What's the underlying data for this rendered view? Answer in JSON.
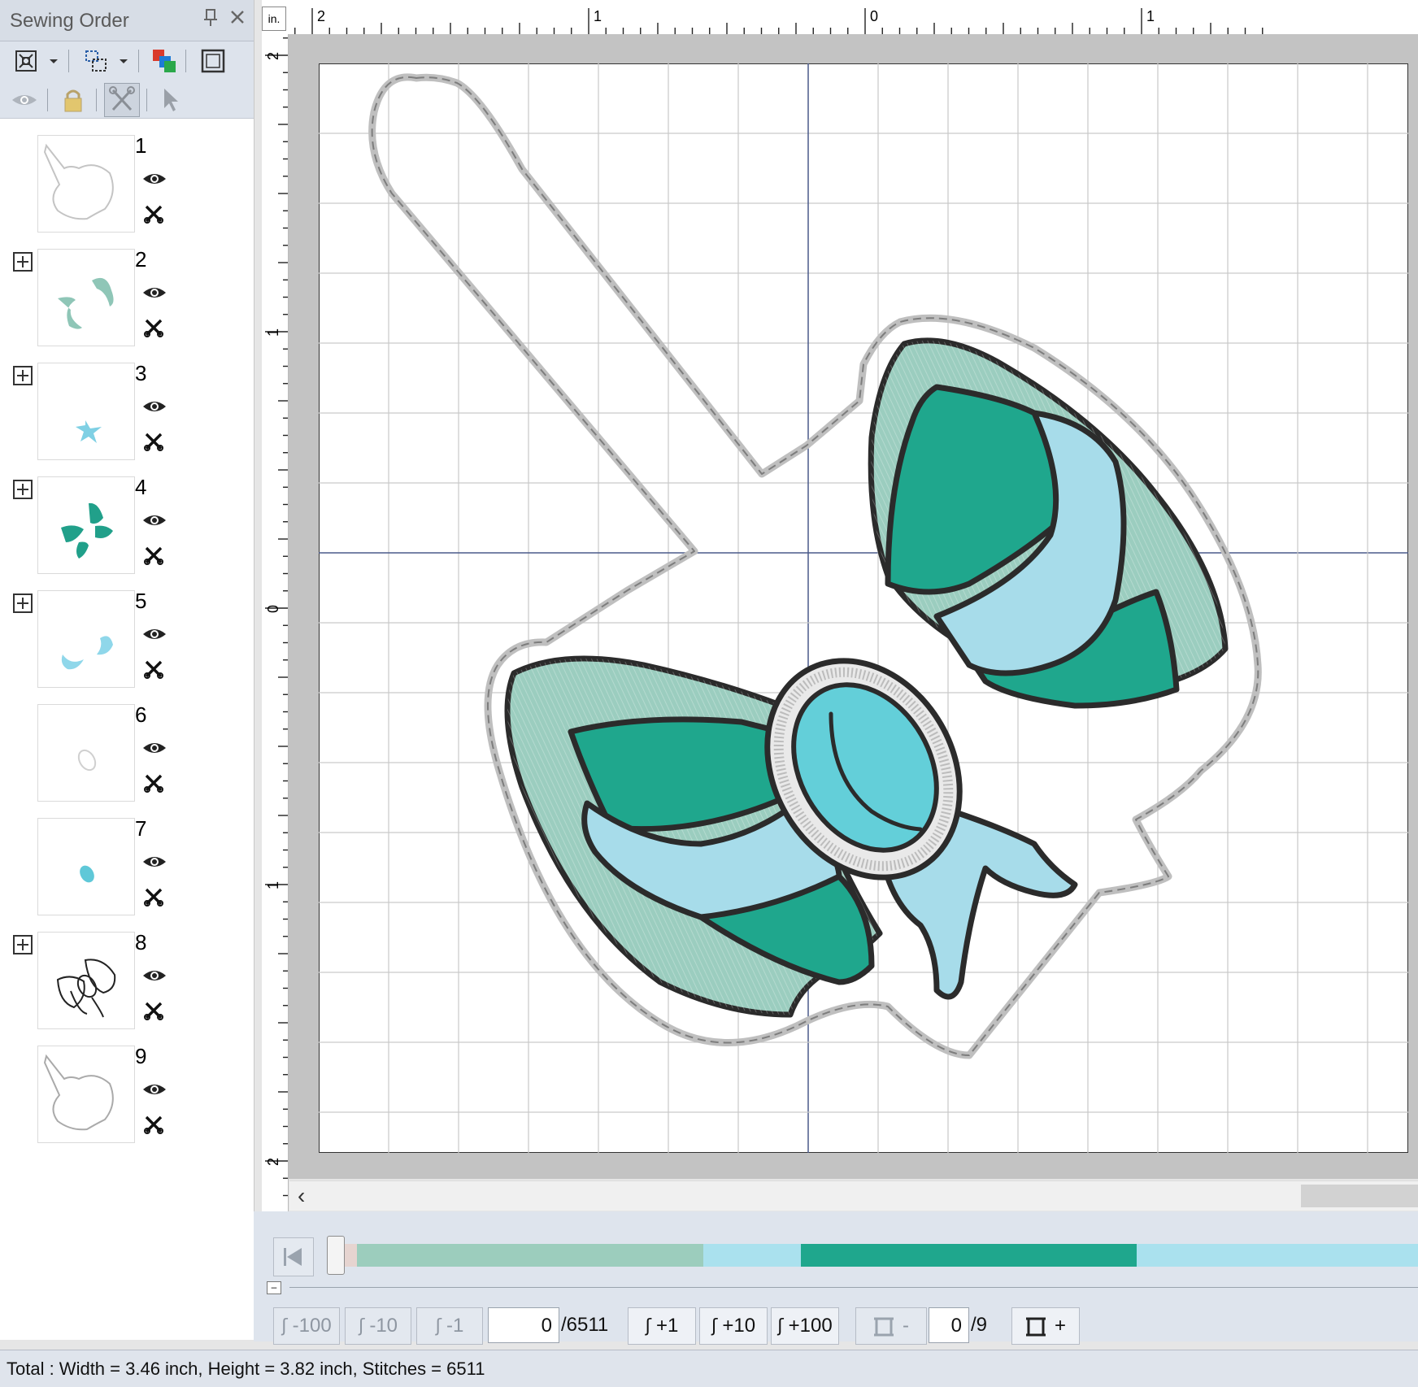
{
  "panel": {
    "title": "Sewing Order",
    "pin_icon": "pin-icon",
    "close_icon": "close-icon",
    "toolbar_row1": [
      "fit-view-icon",
      "group-icon",
      "color-sort-icon",
      "hoop-icon"
    ],
    "toolbar_row2": [
      "eye-icon",
      "lock-icon",
      "scissors-icon",
      "cursor-icon"
    ],
    "items": [
      {
        "number": "1",
        "expandable": false,
        "color": "#bdbdbd"
      },
      {
        "number": "2",
        "expandable": true,
        "color": "#8fc6b7"
      },
      {
        "number": "3",
        "expandable": true,
        "color": "#7fd0e4"
      },
      {
        "number": "4",
        "expandable": true,
        "color": "#21a08a"
      },
      {
        "number": "5",
        "expandable": true,
        "color": "#8fd7ea"
      },
      {
        "number": "6",
        "expandable": false,
        "color": "#d0d0d0"
      },
      {
        "number": "7",
        "expandable": false,
        "color": "#5fc8d8"
      },
      {
        "number": "8",
        "expandable": true,
        "color": "#222222"
      },
      {
        "number": "9",
        "expandable": false,
        "color": "#bdbdbd"
      }
    ]
  },
  "ruler": {
    "unit": "in.",
    "top_labels": [
      "2",
      "1",
      "0",
      "1"
    ],
    "left_labels": [
      "2",
      "1",
      "0",
      "1",
      "2"
    ]
  },
  "colors": {
    "mint": "#9bcdbf",
    "teal": "#1fa78d",
    "lightblue": "#a7dcea",
    "aqua": "#63cfd9",
    "outline": "#2b2b2b",
    "satin": "#bcbcbc"
  },
  "stitch_bar": {
    "segments": [
      {
        "color": "#e6d4d0",
        "fraction": 0.02
      },
      {
        "color": "#9ccdbd",
        "fraction": 0.32
      },
      {
        "color": "#aae1ee",
        "fraction": 0.09
      },
      {
        "color": "#1fa78d",
        "fraction": 0.31
      },
      {
        "color": "#aae1ee",
        "fraction": 0.26
      }
    ]
  },
  "controls": {
    "minus100": "-100",
    "minus10": "-10",
    "minus1": "-1",
    "stitch_current": "0",
    "stitch_total": "/6511",
    "plus1": "+1",
    "plus10": "+10",
    "plus100": "+100",
    "hoop_minus": "-",
    "color_current": "0",
    "color_total": "/9",
    "hoop_plus": "+"
  },
  "status": {
    "text": "Total : Width = 3.46 inch, Height = 3.82 inch, Stitches = 6511"
  }
}
